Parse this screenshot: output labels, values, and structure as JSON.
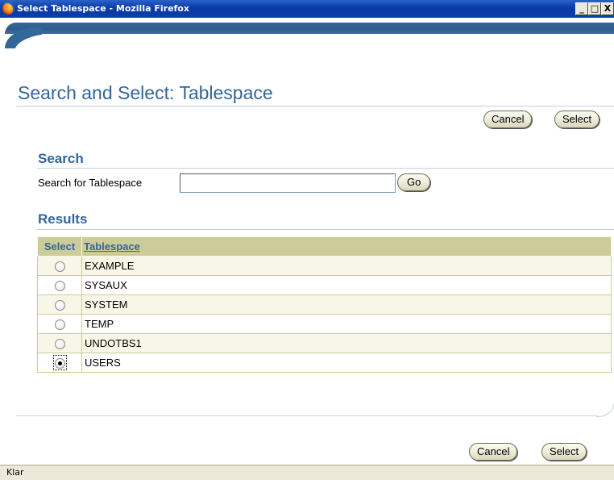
{
  "window": {
    "title": "Select Tablespace - Mozilla Firefox",
    "buttons": {
      "minimize": "_",
      "maximize": "□",
      "close": "X"
    }
  },
  "page": {
    "title": "Search and Select: Tablespace",
    "top_buttons": {
      "cancel": "Cancel",
      "select": "Select"
    },
    "bottom_buttons": {
      "cancel": "Cancel",
      "select": "Select"
    }
  },
  "search": {
    "heading": "Search",
    "label": "Search for Tablespace",
    "value": "",
    "go_label": "Go"
  },
  "results": {
    "heading": "Results",
    "columns": {
      "select": "Select",
      "tablespace": "Tablespace"
    },
    "rows": [
      {
        "name": "EXAMPLE",
        "selected": false
      },
      {
        "name": "SYSAUX",
        "selected": false
      },
      {
        "name": "SYSTEM",
        "selected": false
      },
      {
        "name": "TEMP",
        "selected": false
      },
      {
        "name": "UNDOTBS1",
        "selected": false
      },
      {
        "name": "USERS",
        "selected": true
      }
    ]
  },
  "status": {
    "text": "Klar"
  },
  "colors": {
    "brand": "#336699",
    "table_header": "#cccc99",
    "row_alt": "#f7f7e7"
  }
}
